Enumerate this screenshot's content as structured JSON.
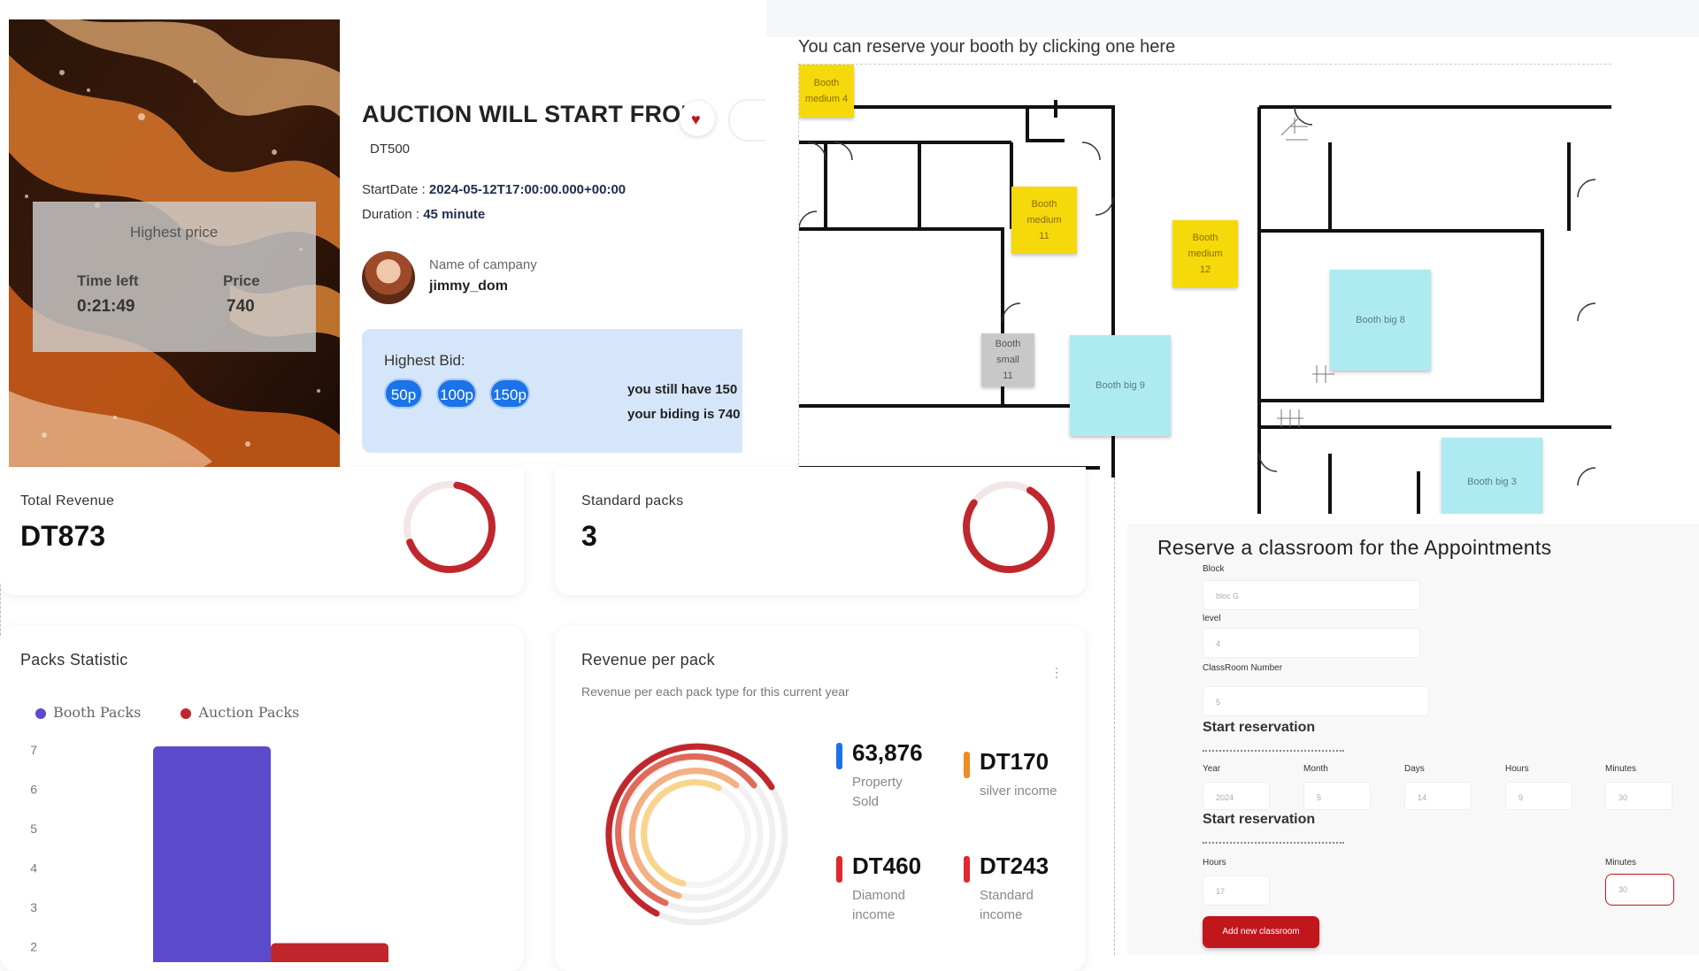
{
  "auction": {
    "overlay": {
      "highest_price_label": "Highest price",
      "time_left_label": "Time left",
      "time_left_value": "0:21:49",
      "price_label": "Price",
      "price_value": "740"
    },
    "title": "AUCTION WILL START FROM",
    "start_value": "DT500",
    "start_date_label": "StartDate :",
    "start_date_value": "2024-05-12T17:00:00.000+00:00",
    "duration_label": "Duration :",
    "duration_value": "45 minute",
    "company_label": "Name of campany",
    "company_value": "jimmy_dom",
    "bid": {
      "label": "Highest Bid:",
      "chips": [
        "50p",
        "100p",
        "150p"
      ],
      "remaining": "you still have 150",
      "your_bid": "your biding is 740"
    }
  },
  "floor_plan": {
    "heading": "You can reserve your booth by clicking one here",
    "booths": [
      {
        "type": "medium",
        "lines": [
          "Booth",
          "medium 4"
        ]
      },
      {
        "type": "medium",
        "lines": [
          "Booth",
          "medium",
          "11"
        ]
      },
      {
        "type": "medium",
        "lines": [
          "Booth",
          "medium",
          "12"
        ]
      },
      {
        "type": "small",
        "lines": [
          "Booth",
          "small",
          "11"
        ]
      },
      {
        "type": "big",
        "lines": [
          "Booth big 9"
        ]
      },
      {
        "type": "big",
        "lines": [
          "Booth big 8"
        ]
      },
      {
        "type": "big",
        "lines": [
          "Booth big 3"
        ]
      }
    ]
  },
  "dashboard": {
    "total_revenue": {
      "label": "Total Revenue",
      "value": "DT873"
    },
    "standard_packs": {
      "label": "Standard packs",
      "value": "3"
    },
    "packs_statistic": {
      "title": "Packs Statistic",
      "legend": [
        "Booth Packs",
        "Auction Packs"
      ],
      "legend_colors": [
        "#5b4bcc",
        "#c0272d"
      ]
    },
    "revenue_per_pack": {
      "title": "Revenue per pack",
      "subtitle": "Revenue per each pack type for this current year",
      "menu": "⋮",
      "items": [
        {
          "value": "63,876",
          "label": "Property Sold",
          "color": "#1a73e8"
        },
        {
          "value": "DT170",
          "label": "silver income",
          "color": "#f08a24"
        },
        {
          "value": "DT460",
          "label": "Diamond income",
          "color": "#e0282e"
        },
        {
          "value": "DT243",
          "label": "Standard income",
          "color": "#e0282e"
        }
      ]
    }
  },
  "chart_data": {
    "type": "bar",
    "title": "Packs Statistic",
    "series": [
      {
        "name": "Booth Packs",
        "values": [
          7
        ]
      },
      {
        "name": "Auction Packs",
        "values": [
          2
        ]
      }
    ],
    "yticks": [
      7,
      6,
      5,
      4,
      3,
      2
    ],
    "ylim": [
      1,
      7
    ],
    "legend_position": "top-left"
  },
  "reservation": {
    "title": "Reserve a classroom for the Appointments",
    "block_label": "Block",
    "block_value": "bloc G",
    "level_label": "level",
    "level_value": "4",
    "room_label": "ClassRoom Number",
    "room_value": "5",
    "start_section": "Start reservation",
    "start_fields": [
      {
        "label": "Year",
        "value": "2024"
      },
      {
        "label": "Month",
        "value": "5"
      },
      {
        "label": "Days",
        "value": "14"
      },
      {
        "label": "Hours",
        "value": "9"
      },
      {
        "label": "Minutes",
        "value": "30"
      }
    ],
    "end_section": "Start reservation",
    "end_hours_label": "Hours",
    "end_hours_value": "17",
    "end_minutes_label": "Minutes",
    "end_minutes_value": "30",
    "submit_label": "Add new classroom",
    "submit_color": "#c0161c"
  }
}
